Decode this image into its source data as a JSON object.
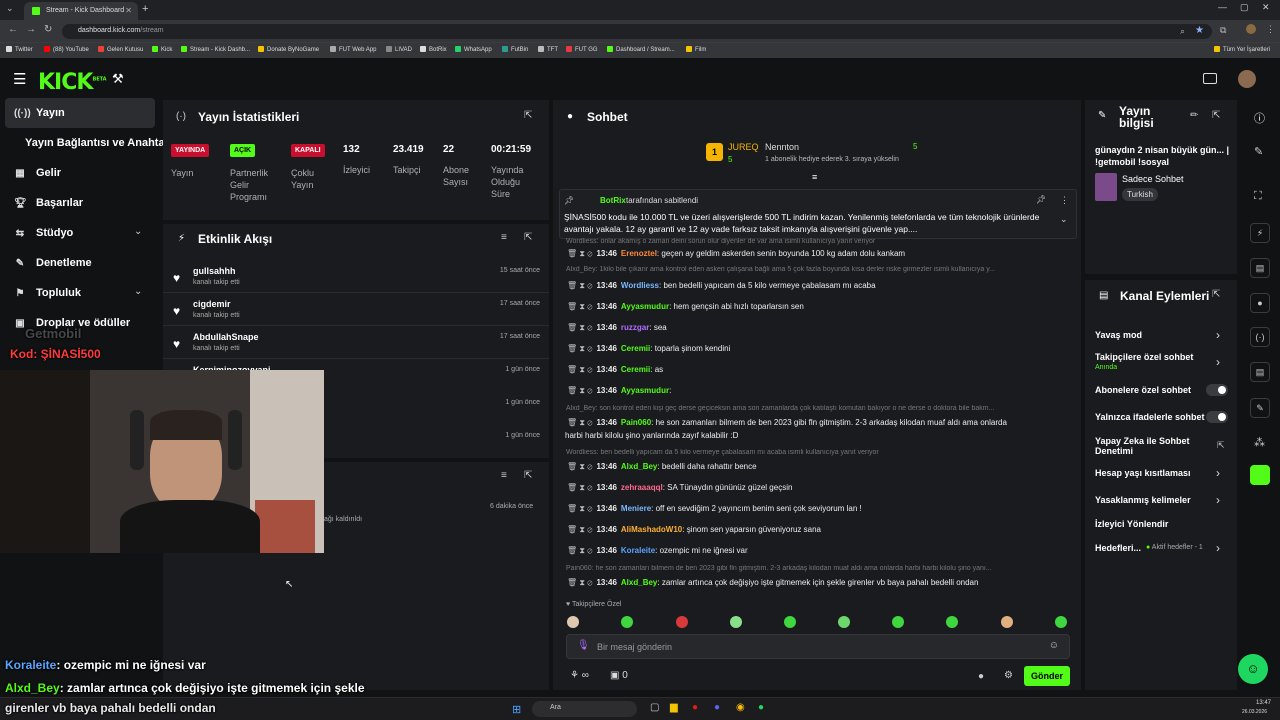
{
  "browser": {
    "tab_title": "Stream - Kick Dashboard",
    "url_domain": "dashboard.kick.com",
    "url_path": "/stream",
    "bookmarks": [
      "Twitter",
      "(88) YouTube",
      "Gelen Kutusu",
      "Kick",
      "Stream - Kick Dashb...",
      "Donate ByNoGame",
      "FUT Web App",
      "LIVAD",
      "BotRix",
      "WhatsApp",
      "FutBin",
      "TFT",
      "FUT GG",
      "Dashboard / Stream...",
      "Film"
    ],
    "all_bookmarks": "Tüm Yer İşaretleri"
  },
  "brand": {
    "logo": "KICK",
    "beta": "BETA",
    "accent": "#53fc18"
  },
  "sidebar": {
    "items": [
      {
        "label": "Yayın",
        "icon": "broadcast-icon"
      },
      {
        "label": "Yayın Bağlantısı ve Anahtarı",
        "icon": ""
      },
      {
        "label": "Gelir",
        "icon": "chart-icon"
      },
      {
        "label": "Başarılar",
        "icon": "trophy-icon"
      },
      {
        "label": "Stüdyo",
        "icon": "studio-icon"
      },
      {
        "label": "Denetleme",
        "icon": "wrench-icon"
      },
      {
        "label": "Topluluk",
        "icon": "community-icon"
      },
      {
        "label": "Droplar ve ödüller",
        "icon": "gift-icon"
      }
    ]
  },
  "stats": {
    "title": "Yayın İstatistikleri",
    "badges": [
      {
        "value": "YAYINDA",
        "label": "Yayın",
        "color": "#e91916"
      },
      {
        "value": "AÇIK",
        "label": "Partnerlik Gelir Programı",
        "color": "#53fc18"
      },
      {
        "value": "KAPALI",
        "label": "Çoklu Yayın",
        "color": "#e91916"
      }
    ],
    "numbers": [
      {
        "value": "132",
        "label": "İzleyici"
      },
      {
        "value": "23.419",
        "label": "Takipçi"
      },
      {
        "value": "22",
        "label": "Abone Sayısı"
      },
      {
        "value": "00:21:59",
        "label": "Yayında Olduğu Süre"
      }
    ]
  },
  "activity": {
    "title": "Etkinlik Akışı",
    "events": [
      {
        "name": "gullsahhh",
        "sub": "kanalı takip etti",
        "time": "15 saat önce"
      },
      {
        "name": "cigdemir",
        "sub": "kanalı takip etti",
        "time": "17 saat önce"
      },
      {
        "name": "AbdullahSnape",
        "sub": "kanalı takip etti",
        "time": "17 saat önce"
      },
      {
        "name": "Kerpiminozovvani",
        "sub": "",
        "time": "1 gün önce"
      },
      {
        "name": "",
        "sub": "",
        "time": "1 gün önce"
      },
      {
        "name": "",
        "sub": "",
        "time": "1 gün önce"
      }
    ],
    "mod_time": "6 dakika önce",
    "mod_sub": "ağı kaldırıldı"
  },
  "overlay": {
    "watermark": "Getmobil",
    "code": "Kod: ŞİNASİ500",
    "chat": [
      {
        "user": "Koraleite",
        "text": ": ozempic mi ne iğnesi var",
        "color": "#5aa5ff"
      },
      {
        "user": "Alxd_Bey",
        "text": ": zamlar artınca çok değişiyo işte gitmemek için şekle",
        "color": "#53fc18"
      },
      {
        "user": "",
        "text": "girenler vb baya pahalı bedelli ondan",
        "color": "#ffffff"
      }
    ]
  },
  "chat": {
    "title": "Sohbet",
    "leaderboard": [
      {
        "name": "JUREQ",
        "count": "5"
      },
      {
        "name": "Nennton",
        "count": "5",
        "note": "1 abonelik hediye ederek 3. sıraya yükselin"
      }
    ],
    "pinned_by": "BotRix",
    "pinned_label": "tarafından sabitlendi",
    "pinned_text": "ŞİNASİ500 kodu ile 10.000 TL ve üzeri alışverişlerde 500 TL indirim kazan.  Yenilenmiş telefonlarda ve tüm teknolojik ürünlerde avantajı yakala. 12 ay garanti ve 12 ay vade farksız taksit imkanıyla alışverişini güvenle yap....",
    "reply_top": "Wordliess: onlar akamış o zaman deini sorun olur diyenler de var ama isimli kullanıcıya yanıt veriyor",
    "messages": [
      {
        "time": "13:46",
        "user": "Erenoztel",
        "color": "#ff8a3d",
        "text": "geçen ay geldim askerden senin boyunda 100 kg adam dolu kankam"
      },
      {
        "reply": "Alxd_Bey: 1kilo bile çıkarır ama kontrol eden askeri çalışana bağlı ama 5 çok fazla boyunda kısa derler riske girmezler isimli kullanıcıya y..."
      },
      {
        "time": "13:46",
        "user": "Wordliess",
        "color": "#7ab8ff",
        "text": "ben bedelli yapıcam da 5 kilo vermeye çabalasam mı acaba"
      },
      {
        "time": "13:46",
        "user": "Ayyasmudur",
        "color": "#53fc18",
        "text": "hem gençsin abi hızlı toparlarsın sen"
      },
      {
        "time": "13:46",
        "user": "ruzzgar",
        "color": "#b46cff",
        "text": "sea"
      },
      {
        "time": "13:46",
        "user": "Ceremii",
        "color": "#53fc18",
        "text": "toparla şinom kendini"
      },
      {
        "time": "13:46",
        "user": "Ceremii",
        "color": "#53fc18",
        "text": "as"
      },
      {
        "time": "13:46",
        "user": "Ayyasmudur",
        "color": "#53fc18",
        "text": ""
      },
      {
        "reply": "Alxd_Bey: son kontrol eden kişi geç derse geçiceksin ama son zamanlarda çok katılaştı komutan bakıyor o ne derse o doktora bile bakm..."
      },
      {
        "time": "13:46",
        "user": "Pain060",
        "color": "#53fc18",
        "text": "he son zamanları bilmem de ben 2023 gibi fln gitmiştim. 2-3 arkadaş kilodan muaf aldı ama onlarda",
        "cont": "harbi harbi kilolu şino yanlarında zayıf kalabilir :D"
      },
      {
        "reply": "Wordliess: ben bedelli yapıcam da 5 kilo vermeye çabalasam mı acaba isimli kullanıcıya yanıt veriyor"
      },
      {
        "time": "13:46",
        "user": "Alxd_Bey",
        "color": "#53fc18",
        "text": "bedelli daha rahattır bence"
      },
      {
        "time": "13:46",
        "user": "zehraaaqql",
        "color": "#ff6b8b",
        "text": "SA Tünaydın gününüz güzel geçsin"
      },
      {
        "time": "13:46",
        "user": "Meniere",
        "color": "#7ab8ff",
        "text": "off en sevdiğim 2 yayıncım benim seni çok seviyorum lan !"
      },
      {
        "time": "13:46",
        "user": "AliMashadoW10",
        "color": "#ffb030",
        "text": "şinom sen yaparsın güveniyoruz sana"
      },
      {
        "time": "13:46",
        "user": "Koraleite",
        "color": "#5aa5ff",
        "text": "ozempic mi ne iğnesi var"
      },
      {
        "reply": "Pain060: he son zamanları bilmem de ben 2023 gibi fln gitmiştim. 2-3 arkadaş kilodan muaf aldı ama onlarda harbi harbi kilolu şino yanı..."
      },
      {
        "time": "13:46",
        "user": "Alxd_Bey",
        "color": "#53fc18",
        "text": "zamlar artınca çok değişiyo işte gitmemek için şekle girenler vb baya pahalı bedelli ondan"
      }
    ],
    "emote_label": "Takipçilere Özel",
    "input_placeholder": "Bir mesaj gönderin",
    "points": "∞",
    "gifts": "0",
    "send_label": "Gönder"
  },
  "stream_info": {
    "title": "Yayın bilgisi",
    "stream_title": "günaydın 2 nisan büyük gün... | !getmobil !sosyal",
    "category": "Sadece Sohbet",
    "tag": "Turkish"
  },
  "channel_actions": {
    "title": "Kanal Eylemleri",
    "items": [
      {
        "label": "Yavaş mod",
        "kind": "arrow"
      },
      {
        "label": "Takipçilere özel sohbet",
        "kind": "arrow",
        "sub": "Anında"
      },
      {
        "label": "Abonelere özel sohbet",
        "kind": "toggle"
      },
      {
        "label": "Yalnızca ifadelerle sohbet",
        "kind": "toggle"
      },
      {
        "label": "Yapay Zeka ile Sohbet Denetimi",
        "kind": "link"
      },
      {
        "label": "Hesap yaşı kısıtlaması",
        "kind": "arrow"
      },
      {
        "label": "Yasaklanmış kelimeler",
        "kind": "arrow"
      },
      {
        "label": "İzleyici Yönlendir",
        "kind": "none"
      },
      {
        "label": "Hedefleri...",
        "kind": "arrow",
        "sub": "Aktif hedefler - 1"
      }
    ]
  },
  "taskbar": {
    "search": "Ara",
    "time": "13:47",
    "date": "26.03.2026"
  }
}
